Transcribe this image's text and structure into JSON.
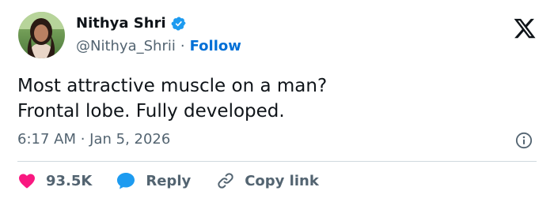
{
  "author": {
    "name": "Nithya Shri",
    "handle": "@Nithya_Shrii",
    "separator": "·",
    "follow_label": "Follow"
  },
  "tweet": {
    "lines": [
      "Most attractive muscle on a man?",
      "Frontal lobe. Fully developed."
    ],
    "time": "6:17 AM · Jan 5, 2026"
  },
  "actions": {
    "likes_count": "93.5K",
    "reply_label": "Reply",
    "copy_link_label": "Copy link"
  },
  "icons": {
    "verified": "verified-badge-icon",
    "brand": "x-logo-icon",
    "info": "info-icon",
    "like": "heart-icon",
    "reply": "speech-bubble-icon",
    "link": "link-icon"
  },
  "colors": {
    "text": "#0f1419",
    "muted": "#536471",
    "link": "#006fd6",
    "verified": "#1d9bf0",
    "heart": "#f91880",
    "divider": "#cfd9de"
  }
}
